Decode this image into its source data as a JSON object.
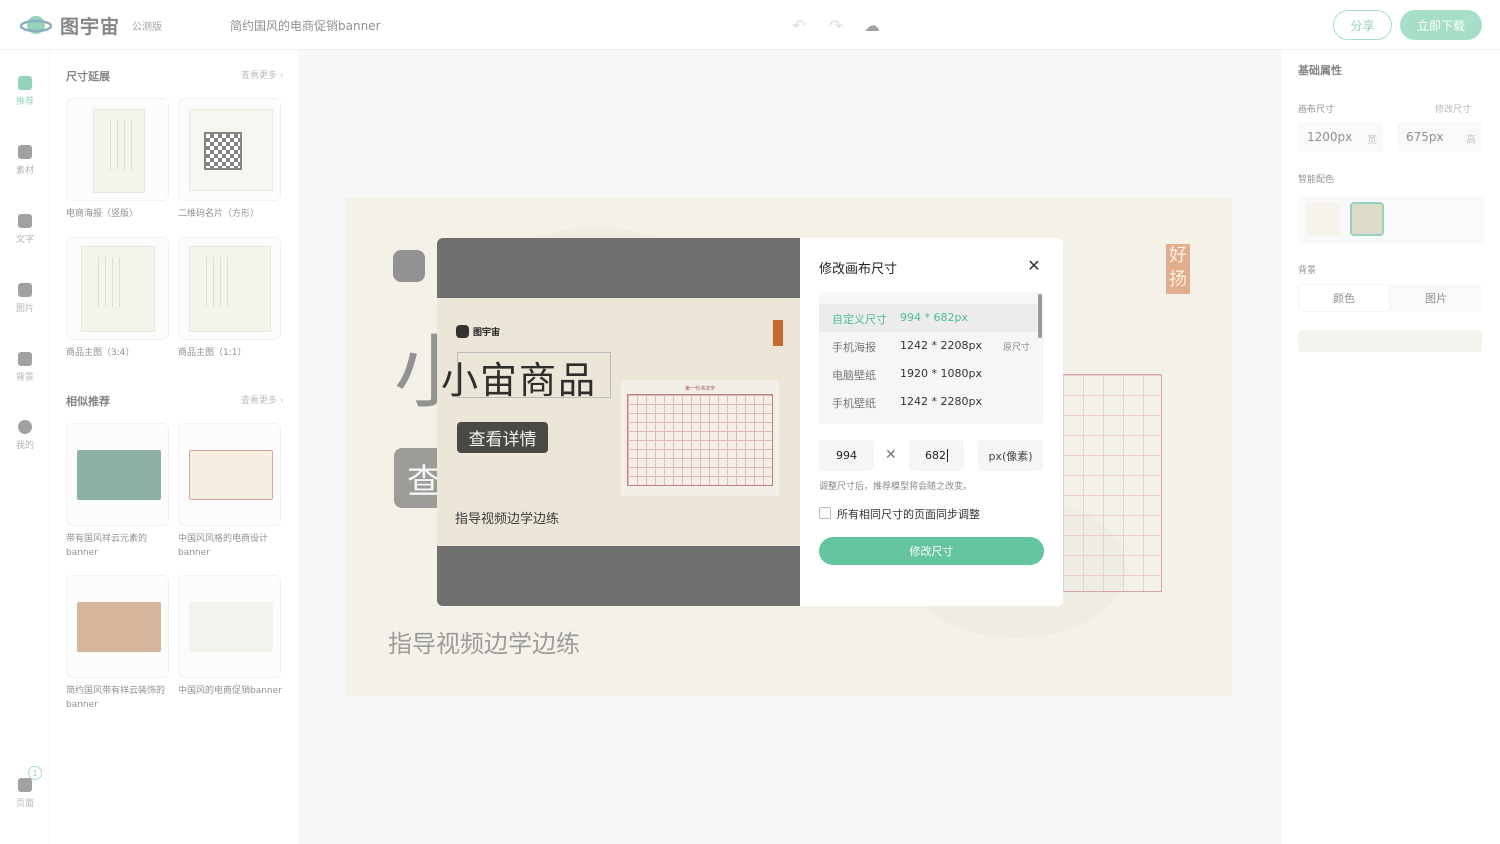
{
  "app": {
    "logo_text": "图宇宙",
    "beta": "公测版",
    "doc_title": "简约国风的电商促销banner",
    "share": "分享",
    "download": "立即下载"
  },
  "rail": {
    "items": [
      "推荐",
      "素材",
      "文字",
      "图片",
      "背景",
      "我的"
    ],
    "pages_label": "页面",
    "pages_count": "1"
  },
  "left_panel": {
    "size_section": "尺寸延展",
    "similar_section": "相似推荐",
    "see_more": "查看更多 ›",
    "size_items": [
      "电商海报（竖版）",
      "二维码名片（方形）",
      "商品主图（3:4）",
      "商品主图（1:1）"
    ],
    "similar_items": [
      "带有国风祥云元素的banner",
      "中国风风格的电商设计banner",
      "简约国风带有祥云装饰的banner",
      "中国风的电商促销banner"
    ]
  },
  "canvas": {
    "big_char": "小",
    "btn_char": "查",
    "subtitle": "指导视频边学边练",
    "seal_text": "好扬"
  },
  "right_panel": {
    "heading": "基础属性",
    "canvas_size_label": "画布尺寸",
    "modify_size_link": "修改尺寸",
    "width_value": "1200px",
    "width_unit": "宽",
    "height_value": "675px",
    "height_unit": "高",
    "smart_color_label": "智能配色",
    "background_label": "背景",
    "bg_tab_color": "颜色",
    "bg_tab_image": "图片",
    "colors": {
      "swatch1": "#efe9dd",
      "swatch2": "#bfbd9f"
    }
  },
  "preview": {
    "logo_text": "图宇宙",
    "title": "小宙商品",
    "button": "查看详情",
    "subtitle": "指导视频边学边练",
    "paper_title": "第一代书法字"
  },
  "modal": {
    "title": "修改画布尺寸",
    "presets": [
      {
        "name": "自定义尺寸",
        "size": "994 * 682px",
        "tag": ""
      },
      {
        "name": "手机海报",
        "size": "1242 * 2208px",
        "tag": "原尺寸"
      },
      {
        "name": "电脑壁纸",
        "size": "1920 * 1080px",
        "tag": ""
      },
      {
        "name": "手机壁纸",
        "size": "1242 * 2280px",
        "tag": ""
      }
    ],
    "width_input": "994",
    "height_input": "682",
    "unit": "px(像素)",
    "hint": "调整尺寸后，推荐模型将会随之改变。",
    "sync_label": "所有相同尺寸的页面同步调整",
    "submit": "修改尺寸"
  }
}
